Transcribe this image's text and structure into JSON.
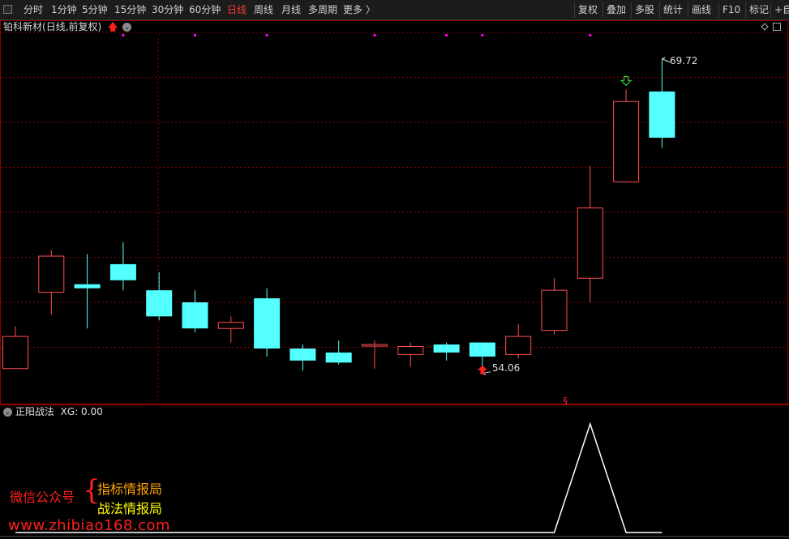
{
  "toolbar": {
    "left_items": [
      {
        "label": "分时"
      },
      {
        "label": "1分钟"
      },
      {
        "label": "5分钟"
      },
      {
        "label": "15分钟"
      },
      {
        "label": "30分钟"
      },
      {
        "label": "60分钟"
      },
      {
        "label": "日线"
      },
      {
        "label": "周线"
      },
      {
        "label": "月线"
      },
      {
        "label": "多周期"
      },
      {
        "label": "更多 〉"
      }
    ],
    "active_item": "日线",
    "right_items": [
      {
        "label": "复权"
      },
      {
        "label": "叠加"
      },
      {
        "label": "多股"
      },
      {
        "label": "统计"
      },
      {
        "label": "画线"
      },
      {
        "label": "F10"
      },
      {
        "label": "标记"
      },
      {
        "label": "+自"
      }
    ]
  },
  "chart": {
    "stock_name": "铂科新材",
    "period_label": "(日线,前复权)",
    "max_price_label": "69.72",
    "min_price_label": "54.06"
  },
  "indicator": {
    "name": "正阳战法",
    "value_label": "XG: 0.00"
  },
  "watermark": {
    "account_label": "微信公众号",
    "brace": "{",
    "line1": "指标情报局",
    "line2": "战法情报局",
    "url": "www.zhibiao168.com"
  },
  "colors": {
    "up": "#ff5050",
    "down": "#54ffff",
    "grid": "#8b0000",
    "magenta_marker": "#ff00ff",
    "indicator_line": "#ffffff"
  },
  "chart_data": {
    "type": "candlestick",
    "ylim": [
      53.2,
      70.8
    ],
    "candles": [
      {
        "open": 54.3,
        "high": 56.4,
        "low": 54.3,
        "close": 55.9
      },
      {
        "open": 58.1,
        "high": 60.2,
        "low": 57.0,
        "close": 59.9
      },
      {
        "open": 58.5,
        "high": 60.0,
        "low": 56.3,
        "close": 58.3
      },
      {
        "open": 59.5,
        "high": 60.6,
        "low": 58.2,
        "close": 58.7
      },
      {
        "open": 58.2,
        "high": 59.1,
        "low": 56.7,
        "close": 56.9
      },
      {
        "open": 57.6,
        "high": 58.2,
        "low": 56.1,
        "close": 56.3
      },
      {
        "open": 56.3,
        "high": 56.9,
        "low": 55.6,
        "close": 56.6
      },
      {
        "open": 57.8,
        "high": 58.3,
        "low": 54.9,
        "close": 55.3
      },
      {
        "open": 55.3,
        "high": 55.5,
        "low": 54.2,
        "close": 54.7
      },
      {
        "open": 55.1,
        "high": 55.7,
        "low": 54.5,
        "close": 54.6
      },
      {
        "open": 55.5,
        "high": 55.7,
        "low": 54.3,
        "close": 55.5
      },
      {
        "open": 55.0,
        "high": 55.6,
        "low": 54.4,
        "close": 55.4
      },
      {
        "open": 55.5,
        "high": 55.6,
        "low": 54.7,
        "close": 55.1
      },
      {
        "open": 55.6,
        "high": 55.6,
        "low": 54.06,
        "close": 54.9
      },
      {
        "open": 55.0,
        "high": 56.5,
        "low": 54.8,
        "close": 55.9
      },
      {
        "open": 56.2,
        "high": 58.8,
        "low": 56.0,
        "close": 58.2
      },
      {
        "open": 58.8,
        "high": 64.4,
        "low": 57.6,
        "close": 62.3
      },
      {
        "open": 63.6,
        "high": 68.2,
        "low": 63.6,
        "close": 67.6
      },
      {
        "open": 68.1,
        "high": 69.72,
        "low": 65.3,
        "close": 65.8
      }
    ],
    "signal_up_arrows": [
      13
    ],
    "signal_down_arrows": [
      17
    ],
    "magenta_markers": [
      3,
      5,
      7,
      10,
      12,
      13,
      16
    ],
    "indicator_values": [
      0,
      0,
      0,
      0,
      0,
      0,
      0,
      0,
      0,
      0,
      0,
      0,
      0,
      0,
      0,
      0,
      1,
      0,
      0
    ]
  }
}
